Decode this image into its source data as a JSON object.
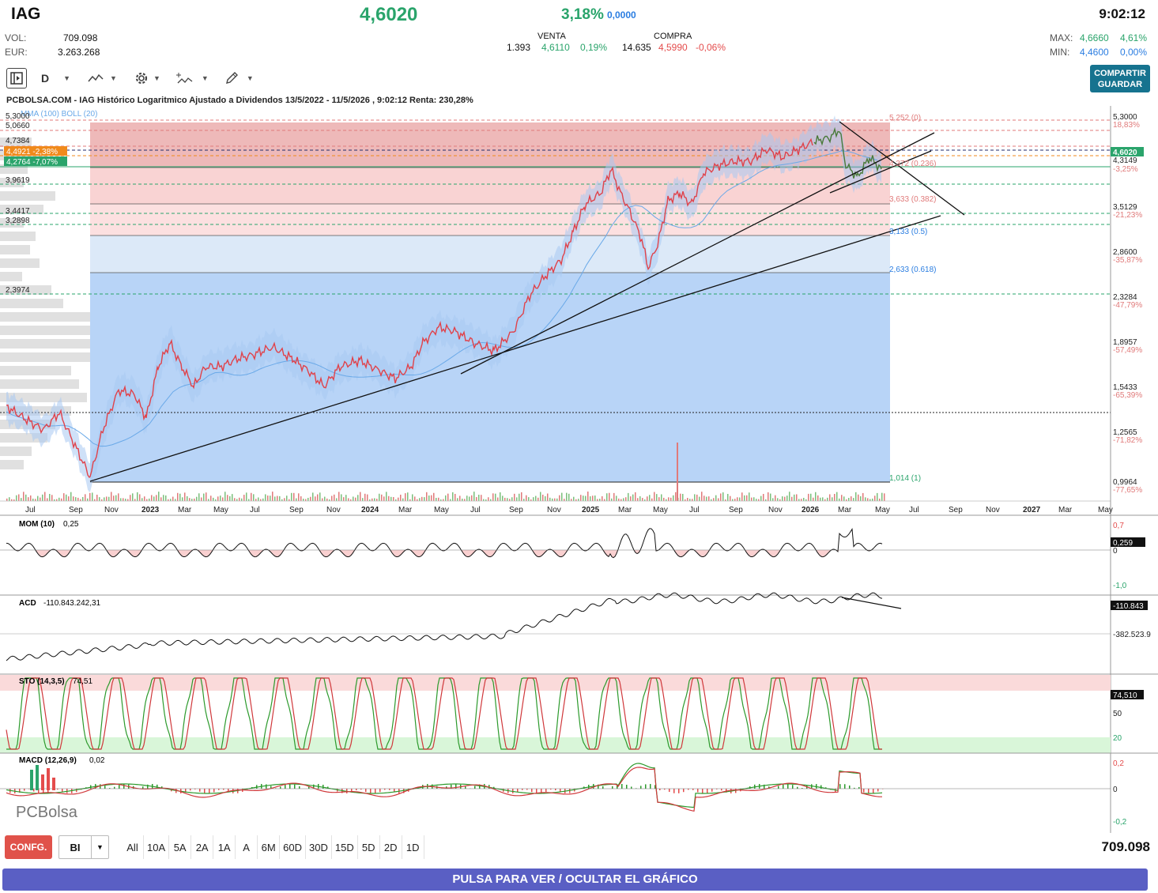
{
  "header": {
    "ticker": "IAG",
    "price": "4,6020",
    "change_pct": "3,18%",
    "change_abs": "0,0000",
    "time": "9:02:12",
    "vol_label": "VOL:",
    "vol_value": "709.098",
    "eur_label": "EUR:",
    "eur_value": "3.263.268",
    "venta_label": "VENTA",
    "venta_qty": "1.393",
    "venta_price": "4,6110",
    "venta_pct": "0,19%",
    "compra_label": "COMPRA",
    "compra_qty": "14.635",
    "compra_price": "4,5990",
    "compra_pct": "-0,06%",
    "max_label": "MAX:",
    "max_value": "4,6660",
    "max_pct": "4,61%",
    "min_label": "MIN:",
    "min_value": "4,4600",
    "min_pct": "0,00%"
  },
  "toolbar": {
    "period": "D",
    "share_line1": "COMPARTIR",
    "share_line2": "GUARDAR"
  },
  "chart": {
    "title": "PCBOLSA.COM - IAG Histórico Logaritmico Ajustado a Dividendos 13/5/2022 - 11/5/2026 , 9:02:12 Renta: 230,28%",
    "overlay_label": "MMA (100)  BOLL (20)",
    "left_levels": [
      "5,3000",
      "5,0660",
      "4,7384",
      "3,9619",
      "3,4417",
      "3,2898",
      "2,3974"
    ],
    "tag_orange": "4,4921 -2,38%",
    "tag_green": "4,2764 -7,07%",
    "right_prices": [
      "5,3000",
      "4,3149",
      "3,5129",
      "2,8600",
      "2,3284",
      "1,8957",
      "1,5433",
      "1,2565",
      "0,9964"
    ],
    "right_pcts": [
      "18,83%",
      "-3,25%",
      "-21,23%",
      "-35,87%",
      "-47,79%",
      "-57,49%",
      "-65,39%",
      "-71,82%",
      "-77,65%"
    ],
    "current_tag": "4,6020",
    "fib_labels": [
      "5,252 (0)",
      "4,372 (0.236)",
      "3,633 (0.382)",
      "3,133 (0.5)",
      "2,633 (0.618)",
      "1,014 (1)"
    ],
    "x_labels": [
      "Jul",
      "Sep",
      "Nov",
      "2023",
      "Mar",
      "May",
      "Jul",
      "Sep",
      "Nov",
      "2024",
      "Mar",
      "May",
      "Jul",
      "Sep",
      "Nov",
      "2025",
      "Mar",
      "May",
      "Jul",
      "Sep",
      "Nov",
      "2026",
      "Mar",
      "May",
      "Jul",
      "Sep",
      "Nov",
      "2027",
      "Mar",
      "May"
    ]
  },
  "indicators": {
    "mom_label": "MOM (10)",
    "mom_value": "0,25",
    "mom_axis": [
      "0,7",
      "0",
      "-1,0"
    ],
    "mom_tag": "0,259",
    "acd_label": "ACD",
    "acd_value": "-110.843.242,31",
    "acd_axis": [
      "-382.523.9"
    ],
    "acd_tag": "-110.843",
    "sto_label": "STO (14,3,5)",
    "sto_value": "74,51",
    "sto_axis": [
      "50",
      "20"
    ],
    "sto_tag": "74,510",
    "macd_label": "MACD (12,26,9)",
    "macd_value": "0,02",
    "macd_axis": [
      "0,2",
      "0",
      "-0,2"
    ]
  },
  "logo": "PCBolsa",
  "bottom": {
    "config": "CONFG.",
    "mode": "BI",
    "ranges": [
      "All",
      "10A",
      "5A",
      "2A",
      "1A",
      "A",
      "6M",
      "60D",
      "30D",
      "15D",
      "5D",
      "2D",
      "1D"
    ],
    "volume_total": "709.098",
    "toggle_label": "PULSA PARA VER / OCULTAR EL GRÁFICO"
  },
  "colors": {
    "up": "#2aa46b",
    "down": "#e44c4c",
    "accent": "#2a7de1",
    "toggle": "#5a5fc4",
    "config": "#e0524a"
  }
}
